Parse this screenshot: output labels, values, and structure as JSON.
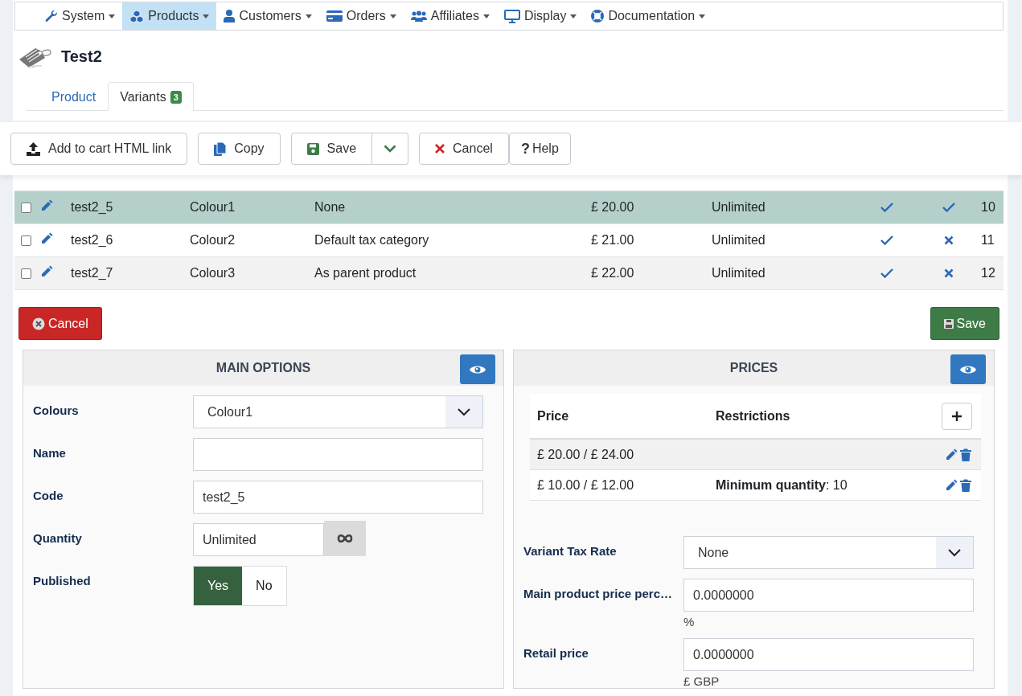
{
  "menu": [
    {
      "label": "System",
      "selected": false
    },
    {
      "label": "Products",
      "selected": true
    },
    {
      "label": "Customers",
      "selected": false
    },
    {
      "label": "Orders",
      "selected": false
    },
    {
      "label": "Affiliates",
      "selected": false
    },
    {
      "label": "Display",
      "selected": false
    },
    {
      "label": "Documentation",
      "selected": false
    }
  ],
  "title": "Test2",
  "tabs": [
    {
      "label": "Product",
      "selected": false
    },
    {
      "label": "Variants",
      "selected": true,
      "badge": "3"
    }
  ],
  "toolbar": [
    {
      "kind": "upload",
      "label": "Add to cart HTML link"
    },
    {
      "kind": "copy",
      "label": "Copy"
    },
    {
      "kind": "save",
      "label": "Save"
    },
    {
      "kind": "cancel",
      "label": "Cancel"
    },
    {
      "kind": "help",
      "label": "Help",
      "glyph": "?"
    }
  ],
  "variants": [
    {
      "selected": true,
      "code": "test2_5",
      "colour": "Colour1",
      "tax": "None",
      "price": "£ 20.00",
      "quantity": "Unlimited",
      "published": true,
      "default": true,
      "id": "10"
    },
    {
      "selected": false,
      "code": "test2_6",
      "colour": "Colour2",
      "tax": "Default tax category",
      "price": "£ 21.00",
      "quantity": "Unlimited",
      "published": true,
      "default": false,
      "id": "11"
    },
    {
      "selected": false,
      "code": "test2_7",
      "colour": "Colour3",
      "tax": "As parent product",
      "price": "£ 22.00",
      "quantity": "Unlimited",
      "published": true,
      "default": false,
      "id": "12"
    }
  ],
  "actions": {
    "cancel": "Cancel",
    "save": "Save"
  },
  "main_options": {
    "title": "MAIN OPTIONS",
    "fields": [
      {
        "kind": "select",
        "label": "Colours",
        "value": "Colour1"
      },
      {
        "kind": "text",
        "label": "Name"
      },
      {
        "kind": "text",
        "label": "Code",
        "value": "test2_5"
      },
      {
        "kind": "quantity",
        "label": "Quantity",
        "value": "Unlimited"
      },
      {
        "kind": "toggle",
        "label": "Published",
        "options": [
          {
            "label": "Yes",
            "selected": true
          },
          {
            "label": "No",
            "selected": false
          }
        ]
      }
    ]
  },
  "prices": {
    "title": "PRICES",
    "columns": [
      "Price",
      "Restrictions"
    ],
    "rows": [
      {
        "price": "£ 20.00 / £ 24.00"
      },
      {
        "price": "£ 10.00 / £ 12.00",
        "restriction": "**Minimum quantity**: 10"
      }
    ],
    "fields": [
      {
        "kind": "select",
        "label": "Variant Tax Rate",
        "value": "None"
      },
      {
        "kind": "text",
        "label": "Main product price perc…",
        "value": "0.0000000",
        "unit": "%"
      },
      {
        "kind": "text",
        "label": "Retail price",
        "value": "0.0000000",
        "unit": "£ GBP"
      }
    ]
  }
}
